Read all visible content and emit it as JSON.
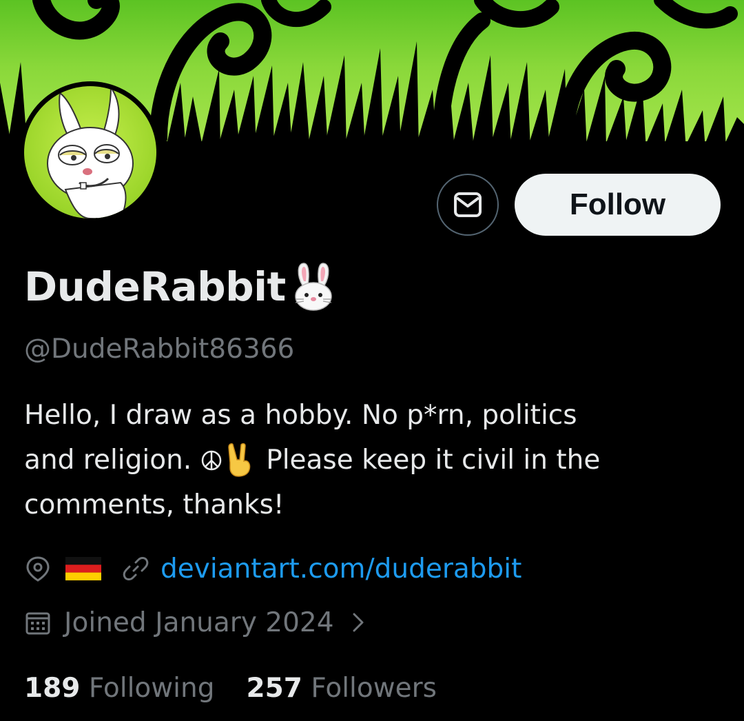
{
  "profile": {
    "display_name": "DudeRabbit",
    "name_emoji": "rabbit-face",
    "handle": "@DudeRabbit86366",
    "bio": {
      "line1": "Hello, I draw as a hobby. No p*rn, politics",
      "line2_a": "and religion.",
      "line2_emojis": [
        "peace-symbol",
        "victory-hand"
      ],
      "line2_b": "Please keep it civil in the",
      "line3": "comments, thanks!"
    },
    "location_flag": "germany-flag",
    "website": "deviantart.com/duderabbit",
    "joined": "Joined January 2024"
  },
  "actions": {
    "message_icon": "envelope-icon",
    "follow_label": "Follow"
  },
  "stats": {
    "following_count": "189",
    "following_label": "Following",
    "followers_count": "257",
    "followers_label": "Followers"
  },
  "colors": {
    "background": "#000000",
    "primary_text": "#e7e9ea",
    "secondary_text": "#71767b",
    "link": "#1d9bf0",
    "banner_green": "#8ad83a",
    "follow_button_bg": "#eff3f4"
  }
}
